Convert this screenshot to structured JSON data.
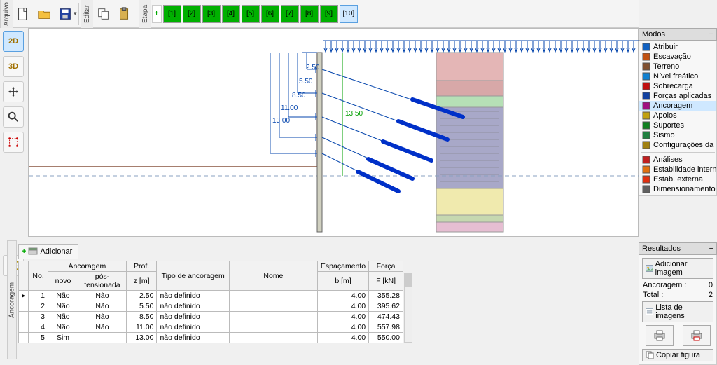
{
  "tabs": {
    "arquivo": "Arquivo",
    "editar": "Editar",
    "etapa": "Etapa"
  },
  "stages": [
    "[1]",
    "[2]",
    "[3]",
    "[4]",
    "[5]",
    "[6]",
    "[7]",
    "[8]",
    "[9]",
    "[10]"
  ],
  "active_stage": 9,
  "left_buttons": {
    "b2d": "2D",
    "b3d": "3D"
  },
  "add_button": "Adicionar",
  "side_tab": "Ancoragem",
  "table": {
    "headers": {
      "no": "No.",
      "anc": "Ancoragem",
      "anc_novo": "novo",
      "anc_pt": "pós-tensionada",
      "prof": "Prof.",
      "prof_sub": "z [m]",
      "tipo": "Tipo de ancoragem",
      "nome": "Nome",
      "esp": "Espaçamento",
      "esp_sub": "b [m]",
      "forca": "Força",
      "forca_sub": "F [kN]"
    },
    "rows": [
      {
        "no": "1",
        "novo": "Não",
        "pt": "Não",
        "z": "2.50",
        "tipo": "não definido",
        "nome": "",
        "b": "4.00",
        "f": "355.28"
      },
      {
        "no": "2",
        "novo": "Não",
        "pt": "Não",
        "z": "5.50",
        "tipo": "não definido",
        "nome": "",
        "b": "4.00",
        "f": "395.62"
      },
      {
        "no": "3",
        "novo": "Não",
        "pt": "Não",
        "z": "8.50",
        "tipo": "não definido",
        "nome": "",
        "b": "4.00",
        "f": "474.43"
      },
      {
        "no": "4",
        "novo": "Não",
        "pt": "Não",
        "z": "11.00",
        "tipo": "não definido",
        "nome": "",
        "b": "4.00",
        "f": "557.98"
      },
      {
        "no": "5",
        "novo": "Sim",
        "pt": "",
        "z": "13.00",
        "tipo": "não definido",
        "nome": "",
        "b": "4.00",
        "f": "550.00"
      }
    ]
  },
  "dims": {
    "d1": "2.50",
    "d2": "5.50",
    "d3": "8.50",
    "d4": "11.00",
    "d5": "13.00",
    "d6": "13.50"
  },
  "modos": {
    "title": "Modos",
    "items": [
      {
        "icon": "#1060c0",
        "label": "Atribuir"
      },
      {
        "icon": "#c05010",
        "label": "Escavação"
      },
      {
        "icon": "#805030",
        "label": "Terreno"
      },
      {
        "icon": "#1080d0",
        "label": "Nível freático"
      },
      {
        "icon": "#c01010",
        "label": "Sobrecarga"
      },
      {
        "icon": "#1040a0",
        "label": "Forças aplicadas"
      },
      {
        "icon": "#a01080",
        "label": "Ancoragem",
        "sel": true
      },
      {
        "icon": "#c0a010",
        "label": "Apoios"
      },
      {
        "icon": "#108020",
        "label": "Suportes"
      },
      {
        "icon": "#208040",
        "label": "Sismo"
      },
      {
        "icon": "#a08010",
        "label": "Configurações da etapa"
      }
    ],
    "group2": [
      {
        "icon": "#c02020",
        "label": "Análises"
      },
      {
        "icon": "#e07010",
        "label": "Estabilidade interna"
      },
      {
        "icon": "#e03010",
        "label": "Estab. externa"
      },
      {
        "icon": "#606060",
        "label": "Dimensionamento"
      }
    ]
  },
  "resultados": {
    "title": "Resultados",
    "add_img": "Adicionar imagem",
    "anc_label": "Ancoragem :",
    "anc_val": "0",
    "tot_label": "Total :",
    "tot_val": "2",
    "lista": "Lista de imagens",
    "copy": "Copiar figura"
  }
}
